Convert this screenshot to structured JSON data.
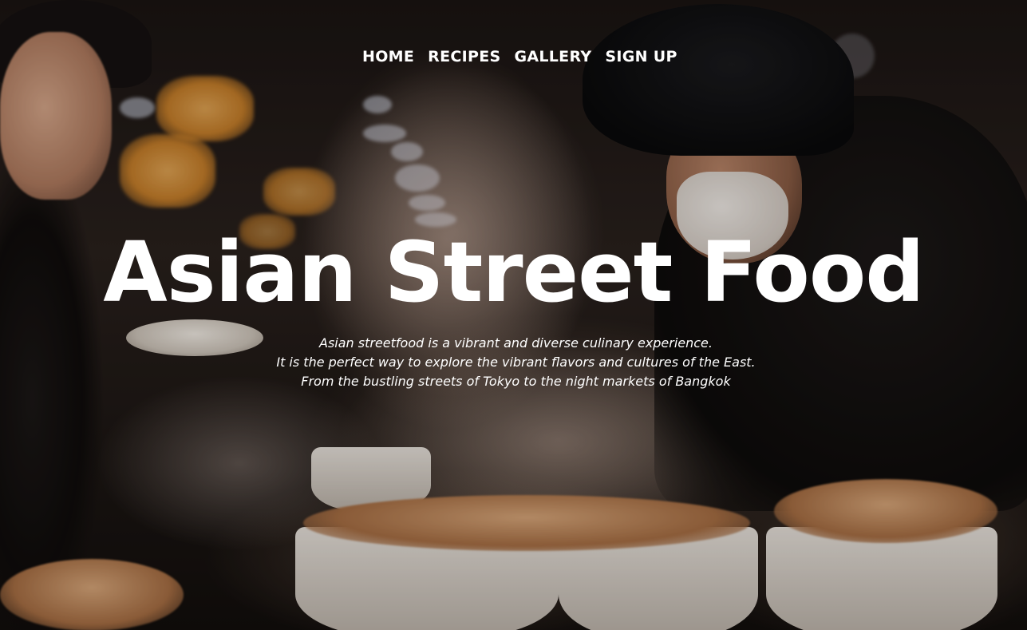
{
  "nav": {
    "items": [
      {
        "label": "HOME"
      },
      {
        "label": "RECIPES"
      },
      {
        "label": "GALLERY"
      },
      {
        "label": "SIGN UP"
      }
    ]
  },
  "hero": {
    "title": "Asian Street Food",
    "description_lines": [
      "Asian streetfood is a vibrant and diverse culinary experience.",
      "It is the perfect way to explore the vibrant flavors and cultures of the East.",
      "From the bustling streets of Tokyo to the night markets of Bangkok"
    ]
  },
  "colors": {
    "text": "#ffffff",
    "background": "#1a1412"
  }
}
